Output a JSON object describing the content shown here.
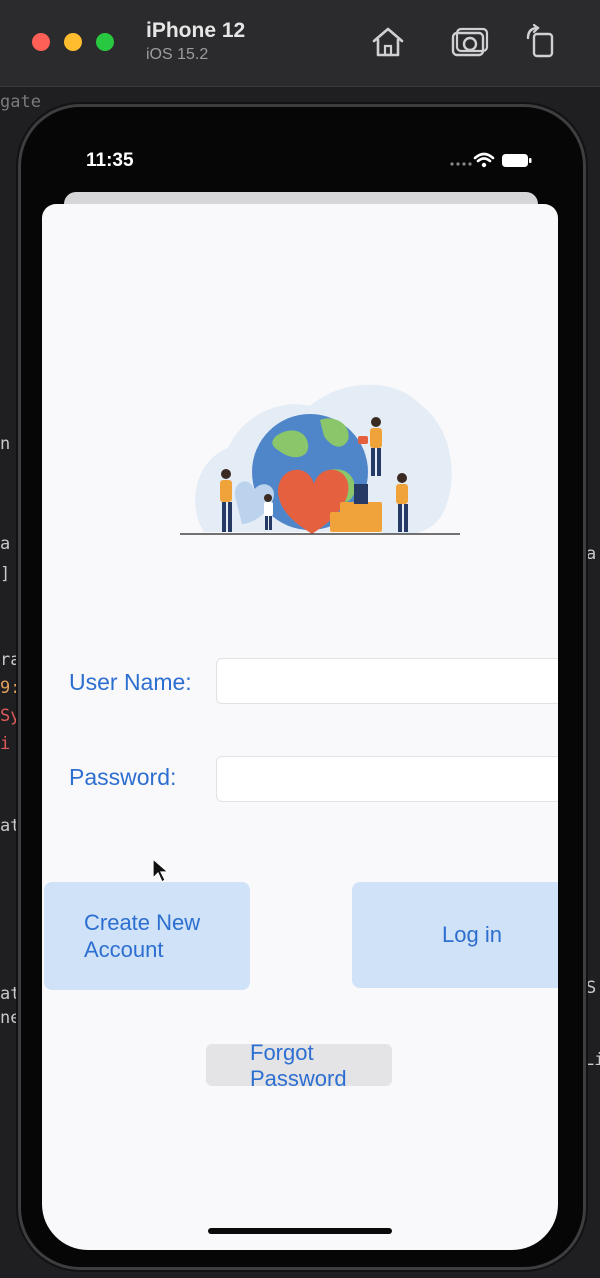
{
  "simulator": {
    "device_name": "iPhone 12",
    "os_version": "iOS 15.2",
    "toolbar_icons": [
      "home-icon",
      "screenshot-icon",
      "rotate-icon"
    ]
  },
  "status_bar": {
    "time": "11:35",
    "icons": [
      "signal-dots-icon",
      "wifi-icon",
      "battery-icon"
    ]
  },
  "form": {
    "username_label": "User Name:",
    "username_value": "",
    "password_label": "Password:",
    "password_value": ""
  },
  "buttons": {
    "create_account_line1": "Create New",
    "create_account_line2": "Account",
    "login": "Log in",
    "forgot_line1": "Forgot",
    "forgot_line2": "Password"
  },
  "colors": {
    "accent": "#2d6fd0",
    "button_fill": "#cfe2f7",
    "screen_bg": "#f9f9fb"
  },
  "background_editor": {
    "fragments": [
      "gate",
      "a",
      "]",
      "ra",
      "9:",
      "Sy",
      "i",
      "at",
      "a",
      "S",
      "at",
      "ne",
      "Li",
      "n"
    ]
  }
}
